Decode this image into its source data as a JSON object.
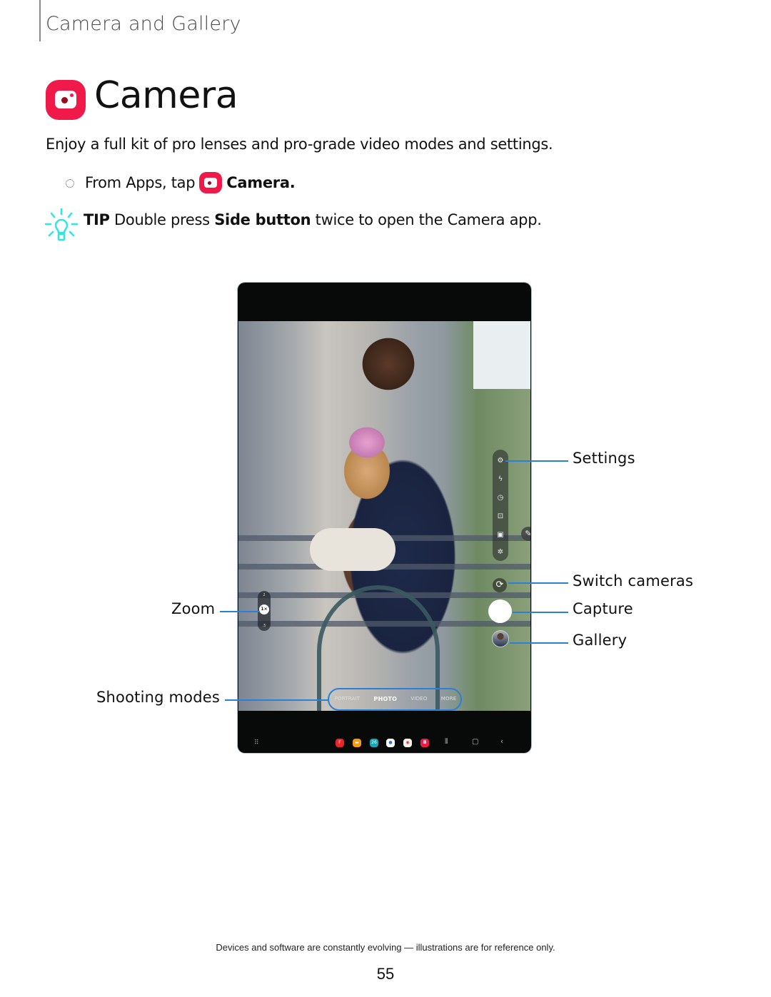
{
  "header": {
    "section_title": "Camera and Gallery"
  },
  "title": {
    "text": "Camera",
    "icon": "camera-app-icon",
    "icon_color": "#f01a4a"
  },
  "intro": "Enjoy a full kit of pro lenses and pro-grade video modes and settings.",
  "step": {
    "prefix": "From Apps, tap",
    "app_name": "Camera",
    "suffix": "."
  },
  "tip": {
    "label": "TIP",
    "text_before": "Double press",
    "bold": "Side button",
    "text_after": "twice to open the Camera app.",
    "icon": "lightbulb-icon",
    "icon_color": "#2ee6e6"
  },
  "device": {
    "toolbar_icons": [
      "settings-gear",
      "flash-off",
      "timer",
      "aspect-ratio",
      "motion-photo",
      "effects"
    ],
    "zoom_levels": [
      "2",
      "1×",
      ".5"
    ],
    "shooting_modes": [
      {
        "label": "PORTRAIT",
        "active": false
      },
      {
        "label": "PHOTO",
        "active": true
      },
      {
        "label": "VIDEO",
        "active": false
      },
      {
        "label": "MORE",
        "active": false
      }
    ],
    "dock_apps": [
      {
        "name": "flipboard",
        "color": "#e8242c",
        "glyph": "F"
      },
      {
        "name": "my-files",
        "color": "#f59a12",
        "glyph": "▬"
      },
      {
        "name": "calendar",
        "color": "#1aa5b8",
        "glyph": "26"
      },
      {
        "name": "messages",
        "color": "#ffffff",
        "glyph": "●"
      },
      {
        "name": "chrome",
        "color": "#f2f2f2",
        "glyph": "◉"
      },
      {
        "name": "camera",
        "color": "#f01a4a",
        "glyph": "◘"
      }
    ],
    "nav_buttons": [
      "recents",
      "home",
      "back"
    ]
  },
  "callouts": {
    "settings": "Settings",
    "switch_cameras": "Switch cameras",
    "capture": "Capture",
    "gallery": "Gallery",
    "zoom": "Zoom",
    "shooting_modes": "Shooting modes",
    "line_color": "#2c7fd6"
  },
  "footer": {
    "disclaimer": "Devices and software are constantly evolving — illustrations are for reference only.",
    "page_number": "55"
  }
}
